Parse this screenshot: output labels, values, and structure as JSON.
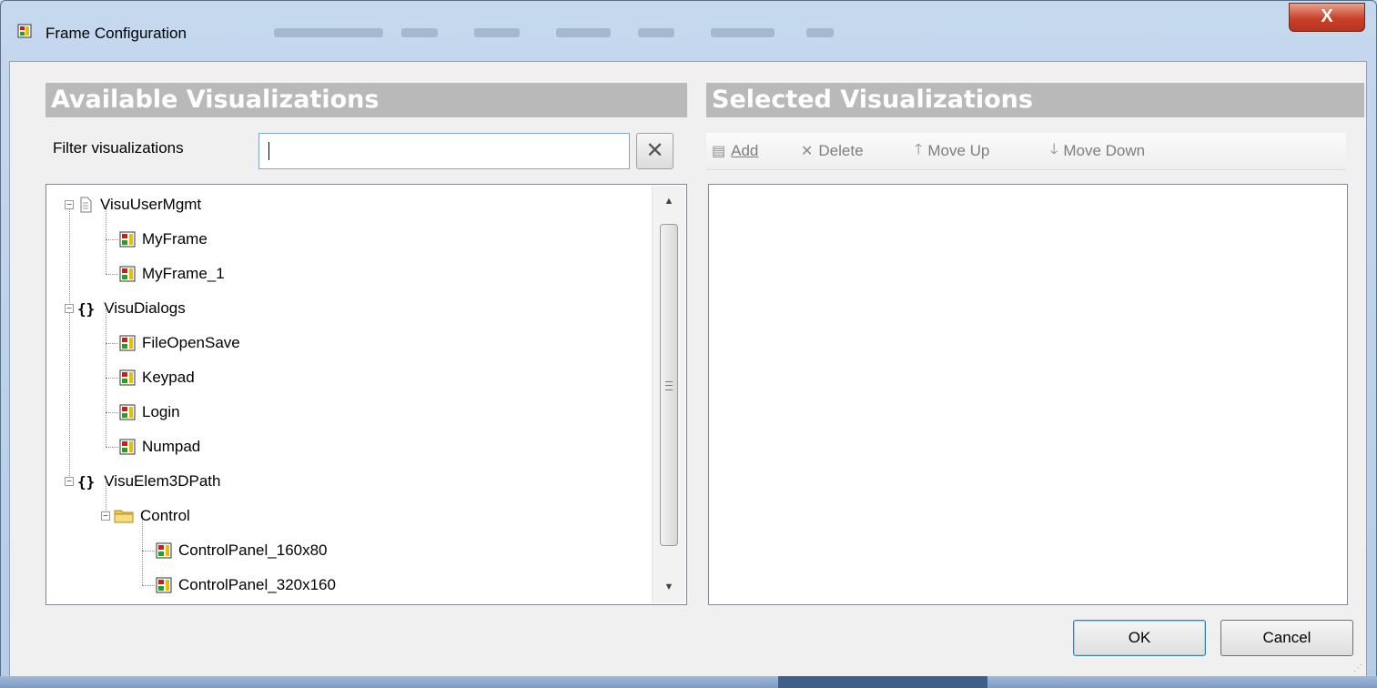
{
  "window": {
    "title": "Frame Configuration",
    "close_label": "X"
  },
  "available": {
    "header": "Available Visualizations",
    "filter_label": "Filter visualizations",
    "filter_value": "",
    "clear_icon": "close-x-icon",
    "tree": [
      {
        "label": "VisuUserMgmt",
        "icon": "file-icon",
        "expanded": true
      },
      {
        "label": "MyFrame",
        "icon": "visualization-icon"
      },
      {
        "label": "MyFrame_1",
        "icon": "visualization-icon"
      },
      {
        "label": "VisuDialogs",
        "icon": "braces-icon",
        "expanded": true
      },
      {
        "label": "FileOpenSave",
        "icon": "visualization-icon"
      },
      {
        "label": "Keypad",
        "icon": "visualization-icon"
      },
      {
        "label": "Login",
        "icon": "visualization-icon"
      },
      {
        "label": "Numpad",
        "icon": "visualization-icon"
      },
      {
        "label": "VisuElem3DPath",
        "icon": "braces-icon",
        "expanded": true
      },
      {
        "label": "Control",
        "icon": "folder-icon",
        "expanded": true
      },
      {
        "label": "ControlPanel_160x80",
        "icon": "visualization-icon"
      },
      {
        "label": "ControlPanel_320x160",
        "icon": "visualization-icon"
      }
    ]
  },
  "selected": {
    "header": "Selected Visualizations",
    "toolbar": {
      "add": "Add",
      "delete": "Delete",
      "move_up": "Move Up",
      "move_down": "Move Down"
    },
    "items": []
  },
  "buttons": {
    "ok": "OK",
    "cancel": "Cancel"
  },
  "colors": {
    "section_header_bg": "#b9b9b9",
    "close_button": "#c9412a",
    "visualization_icon_red": "#d11a1a",
    "visualization_icon_green": "#2e9a2e",
    "folder_yellow": "#f0c850"
  }
}
